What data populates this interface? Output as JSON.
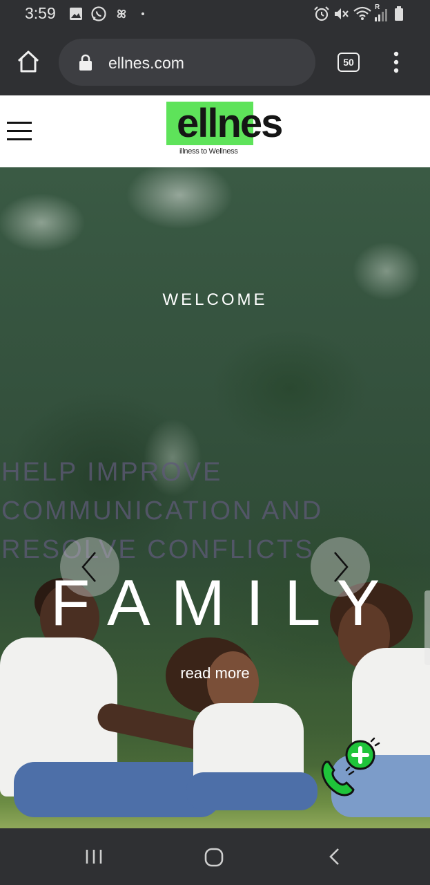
{
  "status_bar": {
    "time": "3:59",
    "left_icons": [
      "image-icon",
      "whatsapp-icon",
      "pinwheel-icon"
    ],
    "right_icons": [
      "alarm-icon",
      "mute-icon",
      "wifi-icon",
      "signal-icon",
      "battery-icon"
    ],
    "signal_badge": "R"
  },
  "browser": {
    "url": "ellnes.com",
    "tab_count": "50"
  },
  "site": {
    "logo_word": "ellnes",
    "logo_tagline": "illness to Wellness"
  },
  "hero": {
    "welcome": "WELCOME",
    "subheading_lines": [
      "HELP IMPROVE",
      "COMMUNICATION AND",
      "RESOLVE CONFLICTS"
    ],
    "title": "FAMILY",
    "read_more": "read more"
  },
  "colors": {
    "logo_green": "#5ee35a",
    "call_green": "#1fc43a",
    "bar_dark": "#2f3033"
  }
}
